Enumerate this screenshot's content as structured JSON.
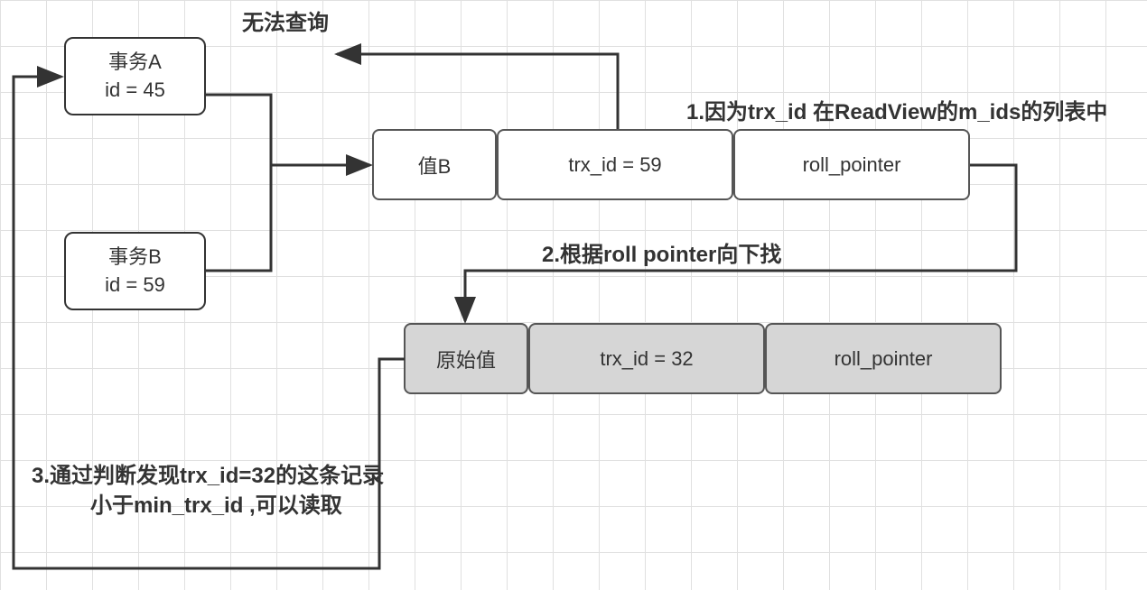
{
  "labels": {
    "top_center": "无法查询",
    "step1": "1.因为trx_id 在ReadView的m_ids的列表中",
    "step2": "2.根据roll pointer向下找",
    "step3_line1": "3.通过判断发现trx_id=32的这条记录",
    "step3_line2": "小于min_trx_id ,可以读取"
  },
  "txA": {
    "name": "事务A",
    "id_line": "id = 45"
  },
  "txB": {
    "name": "事务B",
    "id_line": "id = 59"
  },
  "row1": {
    "value": "值B",
    "trx": "trx_id = 59",
    "roll": "roll_pointer"
  },
  "row2": {
    "value": "原始值",
    "trx": "trx_id = 32",
    "roll": "roll_pointer"
  }
}
